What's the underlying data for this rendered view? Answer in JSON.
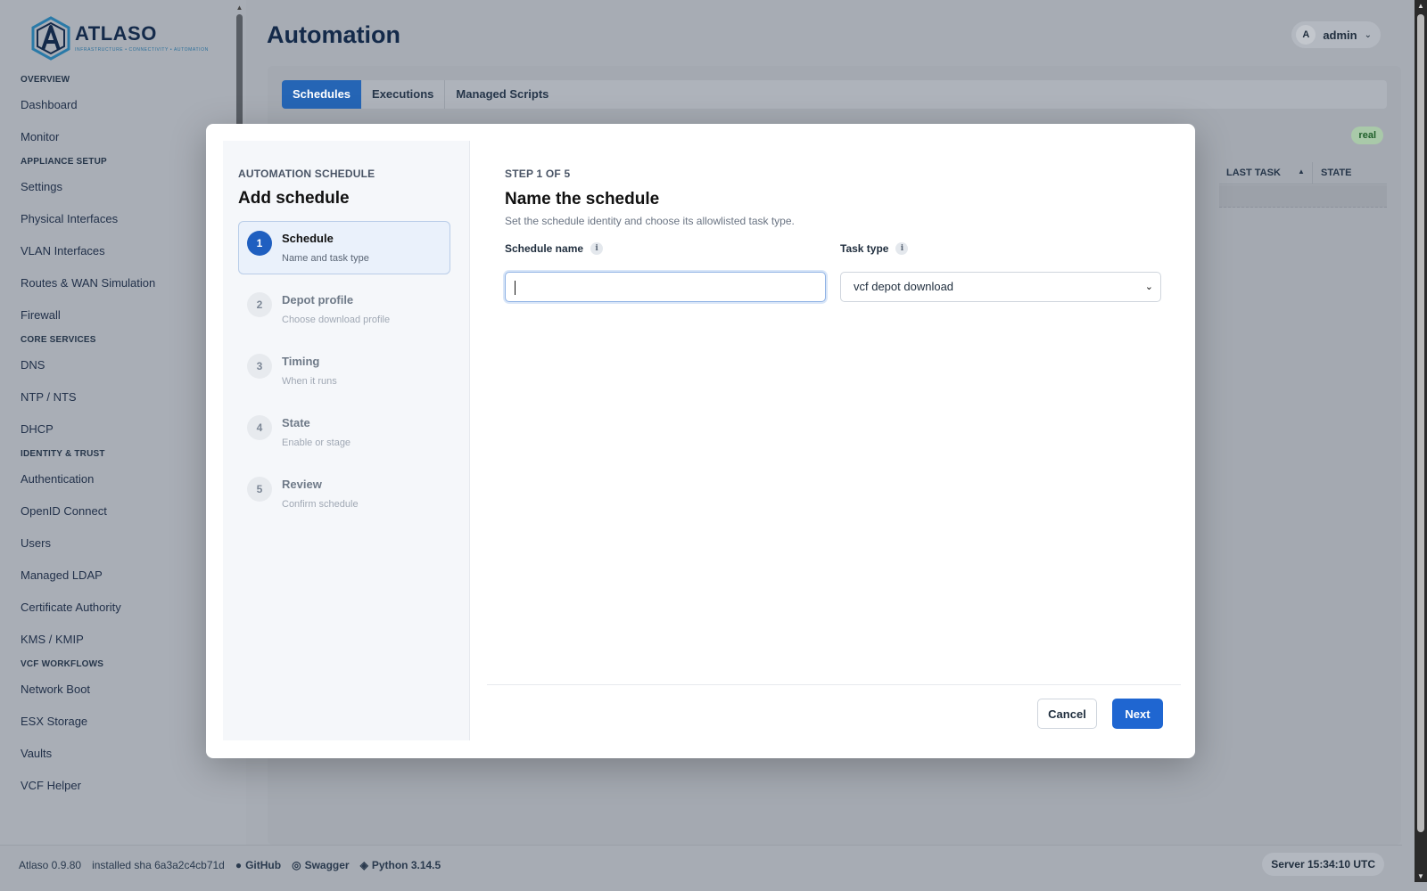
{
  "app": {
    "logo_name": "ATLASO",
    "logo_tagline": "INFRASTRUCTURE • CONNECTIVITY • AUTOMATION"
  },
  "sidebar": {
    "sections": [
      {
        "title": "OVERVIEW",
        "items": [
          "Dashboard",
          "Monitor"
        ]
      },
      {
        "title": "APPLIANCE SETUP",
        "items": [
          "Settings",
          "Physical Interfaces",
          "VLAN Interfaces",
          "Routes & WAN Simulation",
          "Firewall"
        ]
      },
      {
        "title": "CORE SERVICES",
        "items": [
          "DNS",
          "NTP / NTS",
          "DHCP"
        ]
      },
      {
        "title": "IDENTITY & TRUST",
        "items": [
          "Authentication",
          "OpenID Connect",
          "Users",
          "Managed LDAP",
          "Certificate Authority",
          "KMS / KMIP"
        ]
      },
      {
        "title": "VCF WORKFLOWS",
        "items": [
          "Network Boot",
          "ESX Storage",
          "Vaults",
          "VCF Helper"
        ]
      }
    ]
  },
  "header": {
    "title": "Automation",
    "user_initial": "A",
    "user_name": "admin"
  },
  "tabs": [
    {
      "label": "Schedules",
      "active": true
    },
    {
      "label": "Executions",
      "active": false
    },
    {
      "label": "Managed Scripts",
      "active": false
    }
  ],
  "background_table": {
    "badge": "real",
    "columns": [
      "LAST TASK",
      "STATE"
    ]
  },
  "footer": {
    "version": "Atlaso 0.9.80",
    "sha": "installed sha 6a3a2c4cb71d",
    "github": "GitHub",
    "swagger": "Swagger",
    "python": "Python 3.14.5",
    "server_time": "Server 15:34:10 UTC"
  },
  "modal": {
    "eyebrow": "AUTOMATION SCHEDULE",
    "title": "Add schedule",
    "steps": [
      {
        "num": "1",
        "title": "Schedule",
        "sub": "Name and task type",
        "active": true
      },
      {
        "num": "2",
        "title": "Depot profile",
        "sub": "Choose download profile",
        "active": false
      },
      {
        "num": "3",
        "title": "Timing",
        "sub": "When it runs",
        "active": false
      },
      {
        "num": "4",
        "title": "State",
        "sub": "Enable or stage",
        "active": false
      },
      {
        "num": "5",
        "title": "Review",
        "sub": "Confirm schedule",
        "active": false
      }
    ],
    "step_label": "STEP 1 OF 5",
    "step_title": "Name the schedule",
    "step_desc": "Set the schedule identity and choose its allowlisted task type.",
    "schedule_name_label": "Schedule name",
    "schedule_name_value": "",
    "task_type_label": "Task type",
    "task_type_value": "vcf depot download",
    "cancel_label": "Cancel",
    "next_label": "Next"
  },
  "colors": {
    "accent": "#1f66d1",
    "tab_active": "#2565b5",
    "overlay": "#a7acb4"
  }
}
